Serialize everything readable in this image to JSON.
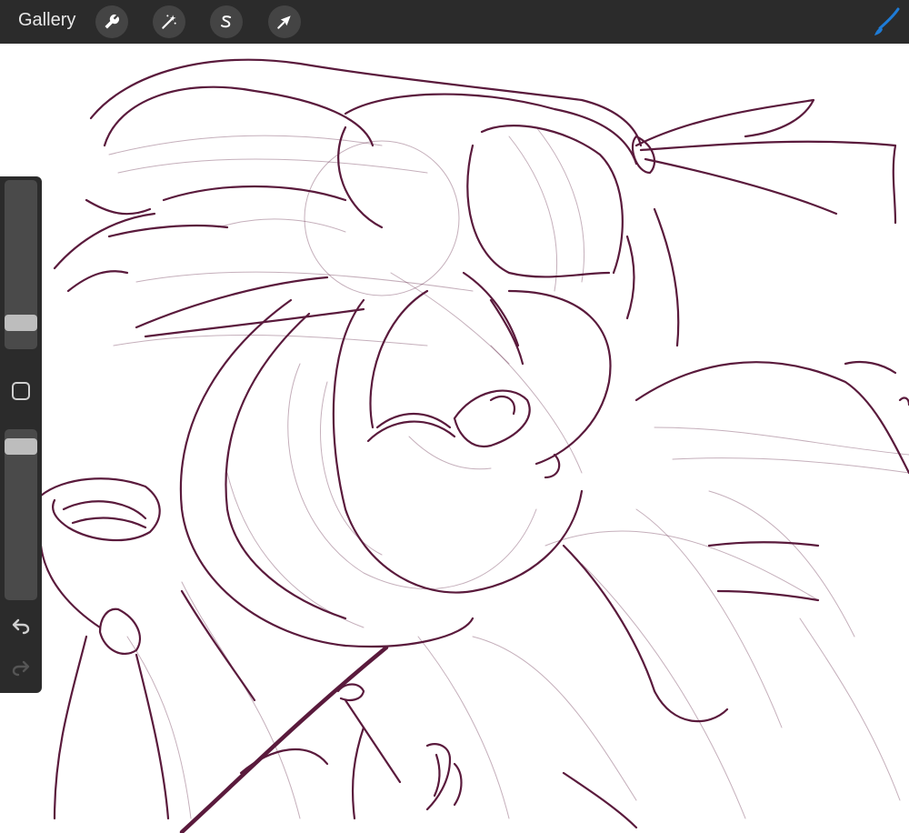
{
  "topbar": {
    "gallery_label": "Gallery",
    "tools": [
      {
        "name": "wrench-icon"
      },
      {
        "name": "magic-wand-icon"
      },
      {
        "name": "selection-s-icon"
      },
      {
        "name": "arrow-cursor-icon"
      }
    ],
    "brush_icon": "brush-icon",
    "brush_color": "#1e7bd6"
  },
  "canvas": {
    "stroke_color": "#5a1a3c",
    "background": "#ffffff"
  },
  "sidebar": {
    "brush_size_level": 0.12,
    "opacity_level": 0.94,
    "icons": [
      "modify-square-icon",
      "undo-icon",
      "redo-icon"
    ]
  }
}
